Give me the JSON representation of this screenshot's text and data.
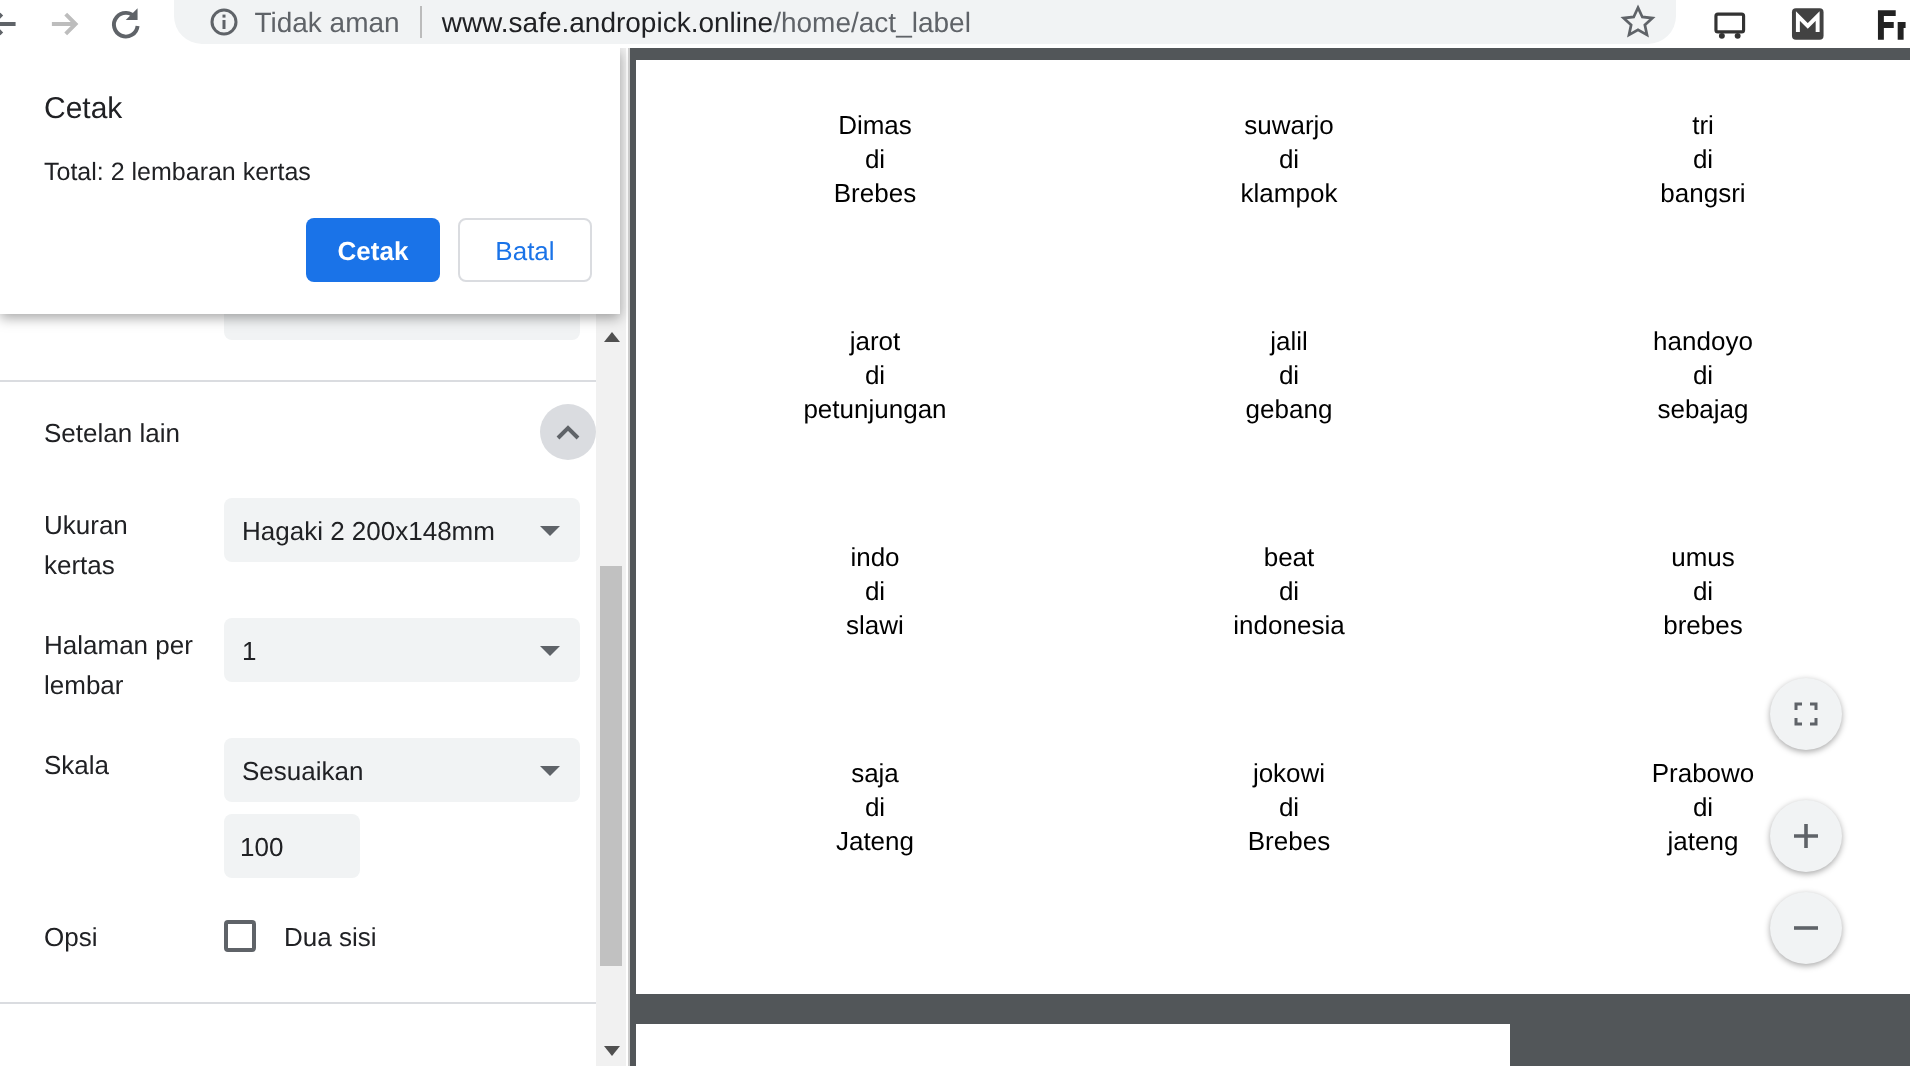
{
  "browser": {
    "security": "Tidak aman",
    "host": "www.safe.andropick.online",
    "path": "/home/act_label"
  },
  "dialog": {
    "title": "Cetak",
    "total": "Total: 2 lembaran kertas",
    "buttons": [
      {
        "label": "Cetak",
        "kind": "primary"
      },
      {
        "label": "Batal",
        "kind": "secondary"
      }
    ]
  },
  "settings": {
    "section": {
      "title": "Setelan lain",
      "expanded": true
    },
    "rows": [
      {
        "label": "Ukuran kertas",
        "kind": "select",
        "value": "Hagaki 2 200x148mm"
      },
      {
        "label": "Halaman per lembar",
        "kind": "select",
        "value": "1"
      },
      {
        "label": "Skala",
        "kind": "select",
        "value": "Sesuaikan",
        "extra": "100"
      },
      {
        "label": "Opsi",
        "kind": "checkbox",
        "option": "Dua sisi",
        "checked": false
      }
    ]
  },
  "labels": [
    {
      "lines": [
        "Dimas",
        "di",
        "Brebes"
      ]
    },
    {
      "lines": [
        "suwarjo",
        "di",
        "klampok"
      ]
    },
    {
      "lines": [
        "tri",
        "di",
        "bangsri"
      ]
    },
    {
      "lines": [
        "jarot",
        "di",
        "petunjungan"
      ]
    },
    {
      "lines": [
        "jalil",
        "di",
        "gebang"
      ]
    },
    {
      "lines": [
        "handoyo",
        "di",
        "sebajag"
      ]
    },
    {
      "lines": [
        "indo",
        "di",
        "slawi"
      ]
    },
    {
      "lines": [
        "beat",
        "di",
        "indonesia"
      ]
    },
    {
      "lines": [
        "umus",
        "di",
        "brebes"
      ]
    },
    {
      "lines": [
        "saja",
        "di",
        "Jateng"
      ]
    },
    {
      "lines": [
        "jokowi",
        "di",
        "Brebes"
      ]
    },
    {
      "lines": [
        "Prabowo",
        "di",
        "jateng"
      ]
    }
  ]
}
